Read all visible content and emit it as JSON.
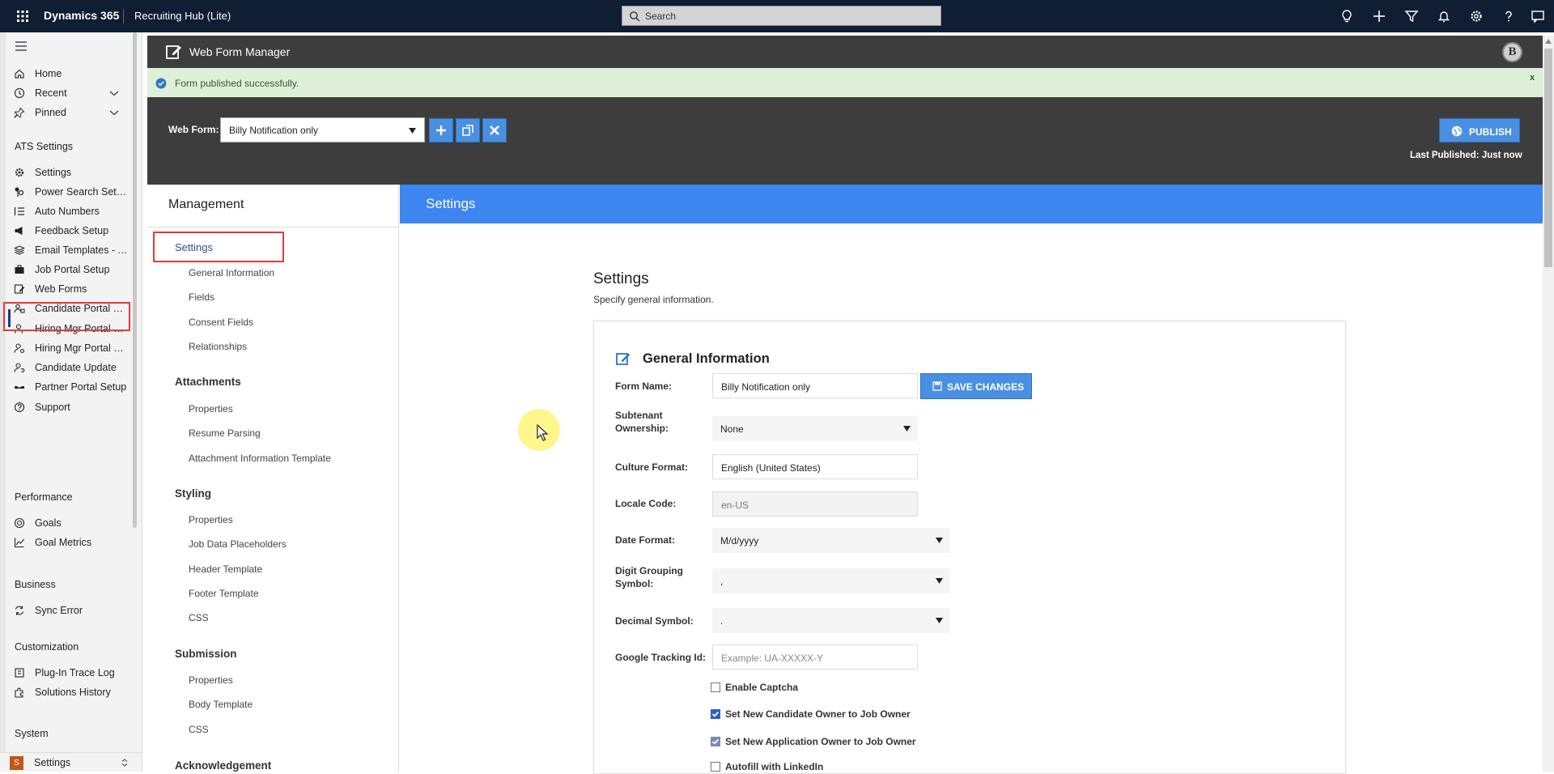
{
  "topbar": {
    "app_name": "Dynamics 365",
    "app_subtitle": "Recruiting Hub (Lite)",
    "search_placeholder": "Search",
    "icons": [
      "lightbulb-icon",
      "plus-icon",
      "filter-icon",
      "bell-icon",
      "gear-icon",
      "help-icon",
      "chat-icon"
    ]
  },
  "nav": {
    "items_top": [
      {
        "label": "Home",
        "icon": "home-icon"
      },
      {
        "label": "Recent",
        "icon": "clock-icon"
      },
      {
        "label": "Pinned",
        "icon": "pin-icon"
      }
    ],
    "sections": {
      "ats": "ATS Settings",
      "performance": "Performance",
      "business": "Business",
      "customization": "Customization",
      "system": "System"
    },
    "ats_items": [
      {
        "label": "Settings"
      },
      {
        "label": "Power Search Settings"
      },
      {
        "label": "Auto Numbers"
      },
      {
        "label": "Feedback Setup"
      },
      {
        "label": "Email Templates - Assignments"
      },
      {
        "label": "Job Portal Setup"
      },
      {
        "label": "Web Forms"
      },
      {
        "label": "Candidate Portal Setup"
      },
      {
        "label": "Hiring Mgr Portal Setup"
      },
      {
        "label": "Hiring Mgr Portal Config"
      },
      {
        "label": "Candidate Update"
      },
      {
        "label": "Partner Portal Setup"
      },
      {
        "label": "Support"
      }
    ],
    "performance_items": [
      {
        "label": "Goals"
      },
      {
        "label": "Goal Metrics"
      }
    ],
    "business_items": [
      {
        "label": "Sync Error"
      }
    ],
    "customization_items": [
      {
        "label": "Plug-In Trace Log"
      },
      {
        "label": "Solutions History"
      }
    ],
    "area": {
      "badge": "S",
      "label": "Settings"
    }
  },
  "wfm": {
    "title": "Web Form Manager",
    "avatar": "B",
    "success_message": "Form published successfully.",
    "close": "x",
    "web_form_label": "Web Form:",
    "web_form_value": "Billy Notification only",
    "publish_label": "PUBLISH",
    "last_published": "Last Published: Just now"
  },
  "management": {
    "title": "Management",
    "settings_link": "Settings",
    "settings_sub": [
      "General Information",
      "Fields",
      "Consent Fields",
      "Relationships"
    ],
    "attachments": {
      "title": "Attachments",
      "items": [
        "Properties",
        "Resume Parsing",
        "Attachment Information Template"
      ]
    },
    "styling": {
      "title": "Styling",
      "items": [
        "Properties",
        "Job Data Placeholders",
        "Header Template",
        "Footer Template",
        "CSS"
      ]
    },
    "submission": {
      "title": "Submission",
      "items": [
        "Properties",
        "Body Template",
        "CSS"
      ]
    },
    "acknowledgement": {
      "title": "Acknowledgement"
    }
  },
  "settings": {
    "banner_title": "Settings",
    "heading": "Settings",
    "subheading": "Specify general information.",
    "card_title": "General Information",
    "save_label": "SAVE CHANGES",
    "fields": {
      "form_name": {
        "label": "Form Name:",
        "value": "Billy Notification only"
      },
      "subtenant": {
        "label_line1": "Subtenant",
        "label_line2": "Ownership:",
        "value": "None"
      },
      "culture": {
        "label": "Culture Format:",
        "value": "English (United States)"
      },
      "locale": {
        "label": "Locale Code:",
        "value": "en-US"
      },
      "date_format": {
        "label": "Date Format:",
        "value": "M/d/yyyy"
      },
      "digit_grouping": {
        "label_line1": "Digit Grouping",
        "label_line2": "Symbol:",
        "value": ","
      },
      "decimal": {
        "label": "Decimal Symbol:",
        "value": "."
      },
      "tracking": {
        "label": "Google Tracking Id:",
        "placeholder": "Example: UA-XXXXX-Y"
      }
    },
    "checkboxes": [
      {
        "label": "Enable Captcha",
        "checked": false
      },
      {
        "label": "Set New Candidate Owner to Job Owner",
        "checked": true
      },
      {
        "label": "Set New Application Owner to Job Owner",
        "checked": true
      },
      {
        "label": "Autofill with LinkedIn",
        "checked": false
      }
    ]
  },
  "colors": {
    "topbar": "#0f1e33",
    "accent": "#3d86f0",
    "button": "#4a90e2",
    "highlight": "#e23b3b",
    "success_bg": "#dff0d8",
    "dark_header": "#3d3d3d"
  }
}
